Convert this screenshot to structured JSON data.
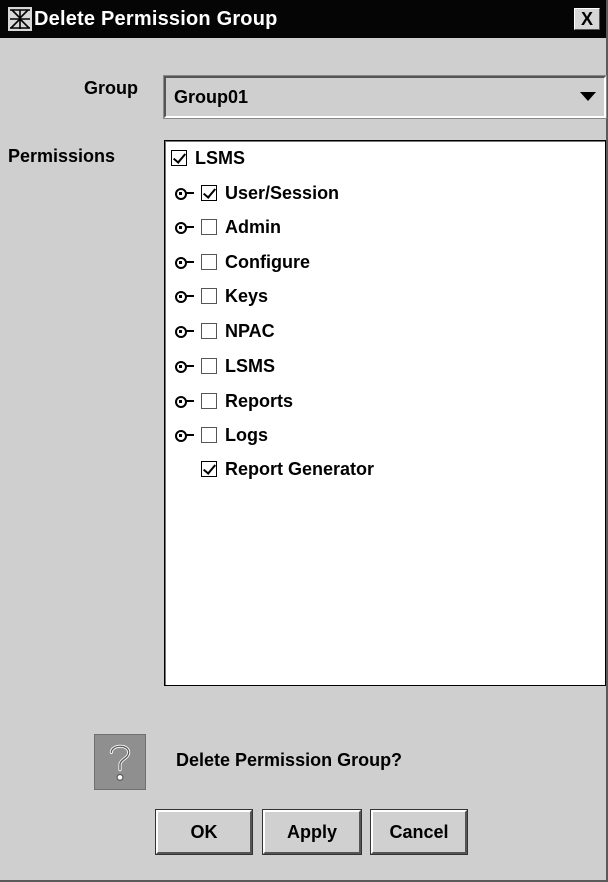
{
  "window": {
    "title": "Delete Permission Group",
    "close_label": "X"
  },
  "form": {
    "group_label": "Group",
    "group_value": "Group01",
    "permissions_label": "Permissions"
  },
  "tree": {
    "root": {
      "label": "LSMS",
      "checked": true
    },
    "items": [
      {
        "label": "User/Session",
        "checked": true,
        "expandable": true
      },
      {
        "label": "Admin",
        "checked": false,
        "expandable": true
      },
      {
        "label": "Configure",
        "checked": false,
        "expandable": true
      },
      {
        "label": "Keys",
        "checked": false,
        "expandable": true
      },
      {
        "label": "NPAC",
        "checked": false,
        "expandable": true
      },
      {
        "label": "LSMS",
        "checked": false,
        "expandable": true
      },
      {
        "label": "Reports",
        "checked": false,
        "expandable": true
      },
      {
        "label": "Logs",
        "checked": false,
        "expandable": true
      },
      {
        "label": "Report Generator",
        "checked": true,
        "expandable": false
      }
    ]
  },
  "dialog": {
    "message": "Delete Permission Group?",
    "icon": "question-icon"
  },
  "buttons": {
    "ok": "OK",
    "apply": "Apply",
    "cancel": "Cancel"
  }
}
